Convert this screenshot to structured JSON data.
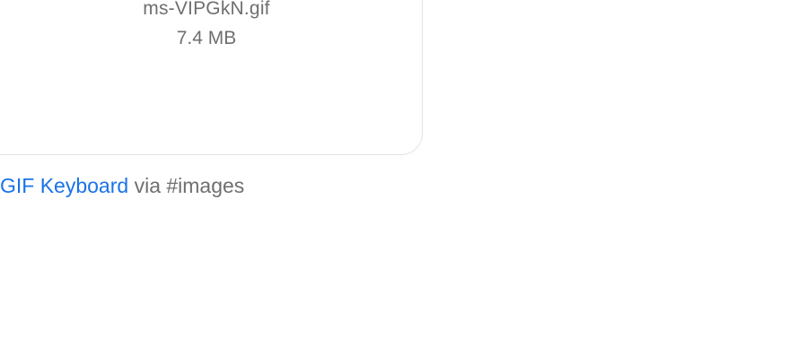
{
  "attachment": {
    "file_name": "ms-VIPGkN.gif",
    "file_size": "7.4 MB"
  },
  "source": {
    "app_link": "GIF Keyboard",
    "via_text": " via #images"
  },
  "colors": {
    "link": "#1a73e8",
    "muted_text": "#6f6f6f",
    "card_border": "#e4e4e4"
  }
}
